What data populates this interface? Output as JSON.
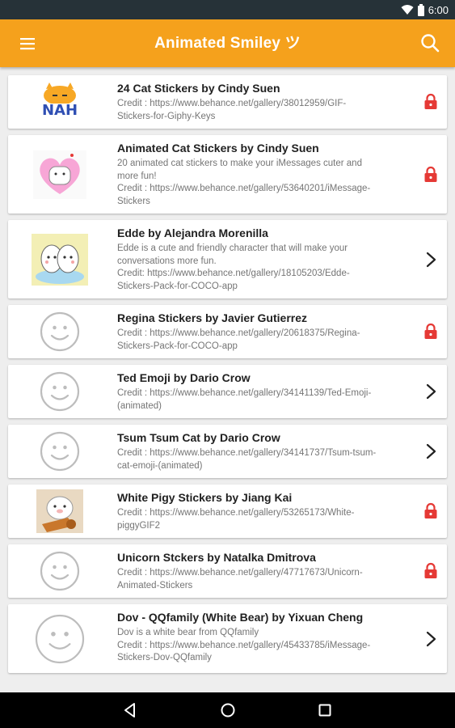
{
  "status_bar": {
    "time": "6:00"
  },
  "app_bar": {
    "title": "Animated Smiley ツ",
    "menu_icon": "hamburger-menu-icon",
    "search_icon": "search-icon"
  },
  "colors": {
    "accent": "#f5a11c",
    "lock": "#e53935"
  },
  "items": [
    {
      "title": "24 Cat Stickers by Cindy Suen",
      "lines": [
        "Credit : https://www.behance.net/gallery/38012959/GIF-",
        "Stickers-for-Giphy-Keys"
      ],
      "thumb": "nah-cat-sticker",
      "status": "locked",
      "thumb_text": "NAH"
    },
    {
      "title": "Animated Cat Stickers by Cindy Suen",
      "lines": [
        "20 animated cat stickers to make your iMessages cuter and",
        "more fun!",
        "Credit : https://www.behance.net/gallery/53640201/iMessage-",
        "Stickers"
      ],
      "thumb": "heart-cat-sticker",
      "status": "locked"
    },
    {
      "title": "Edde by Alejandra Morenilla",
      "lines": [
        "Edde is a cute and friendly character that will make your",
        "conversations more fun.",
        "Credit: https://www.behance.net/gallery/18105203/Edde-",
        "Stickers-Pack-for-COCO-app"
      ],
      "thumb": "edde-sticker",
      "status": "open"
    },
    {
      "title": "Regina Stickers by Javier Gutierrez",
      "lines": [
        "Credit : https://www.behance.net/gallery/20618375/Regina-",
        "Stickers-Pack-for-COCO-app"
      ],
      "thumb": "smiley-placeholder",
      "status": "locked"
    },
    {
      "title": "Ted Emoji by Dario Crow",
      "lines": [
        "Credit : https://www.behance.net/gallery/34141139/Ted-Emoji-",
        "(animated)"
      ],
      "thumb": "smiley-placeholder",
      "status": "open"
    },
    {
      "title": "Tsum Tsum Cat by Dario Crow",
      "lines": [
        "Credit : https://www.behance.net/gallery/34141737/Tsum-tsum-",
        "cat-emoji-(animated)"
      ],
      "thumb": "smiley-placeholder",
      "status": "open"
    },
    {
      "title": "White Pigy Stickers by Jiang Kai",
      "lines": [
        "Credit : https://www.behance.net/gallery/53265173/White-",
        "piggyGIF2"
      ],
      "thumb": "pig-guitar-sticker",
      "status": "locked"
    },
    {
      "title": "Unicorn Stckers by Natalka Dmitrova",
      "lines": [
        "Credit : https://www.behance.net/gallery/47717673/Unicorn-",
        "Animated-Stickers"
      ],
      "thumb": "smiley-placeholder",
      "status": "locked"
    },
    {
      "title": "Dov - QQfamily (White Bear) by Yixuan Cheng",
      "lines": [
        "Dov is a white bear from QQfamily",
        "Credit : https://www.behance.net/gallery/45433785/iMessage-",
        "Stickers-Dov-QQfamily"
      ],
      "thumb": "smiley-placeholder-large",
      "status": "open"
    }
  ],
  "nav_bar": {
    "back_icon": "back-triangle-icon",
    "home_icon": "home-circle-icon",
    "recents_icon": "recents-square-icon"
  }
}
